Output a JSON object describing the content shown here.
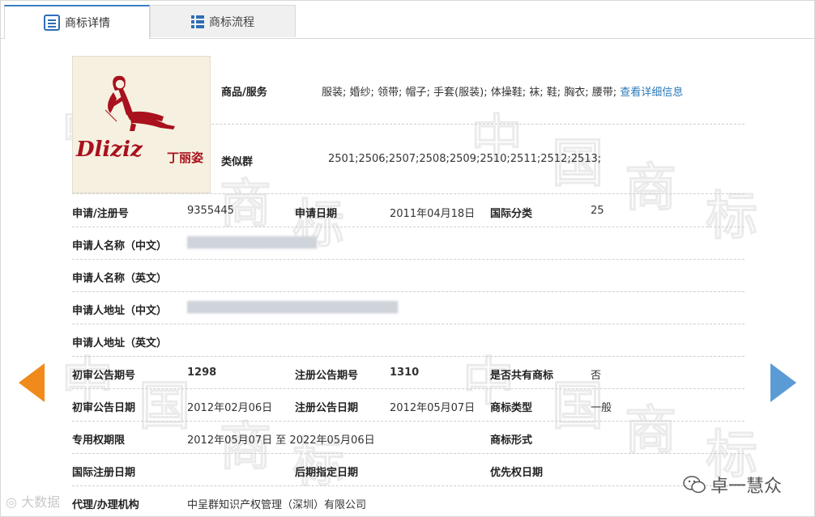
{
  "tabs": [
    {
      "label": "商标详情",
      "active": true
    },
    {
      "label": "商标流程",
      "active": false
    }
  ],
  "logo": {
    "latin_text": "Dliziz",
    "cn_text": "丁丽姿"
  },
  "goods": {
    "label": "商品/服务",
    "value": "服装; 婚纱; 领带; 帽子; 手套(服装); 体操鞋; 袜; 鞋; 胸衣; 腰带;",
    "link": "查看详细信息"
  },
  "similar_group": {
    "label": "类似群",
    "value": "2501;2506;2507;2508;2509;2510;2511;2512;2513;"
  },
  "fields": {
    "reg_no_label": "申请/注册号",
    "reg_no": "9355445",
    "apply_date_label": "申请日期",
    "apply_date": "2011年04月18日",
    "intl_class_label": "国际分类",
    "intl_class": "25",
    "applicant_cn_label": "申请人名称（中文）",
    "applicant_en_label": "申请人名称（英文）",
    "address_cn_label": "申请人地址（中文）",
    "address_en_label": "申请人地址（英文）",
    "prelim_no_label": "初审公告期号",
    "prelim_no": "1298",
    "reg_pub_no_label": "注册公告期号",
    "reg_pub_no": "1310",
    "shared_label": "是否共有商标",
    "shared": "否",
    "prelim_date_label": "初审公告日期",
    "prelim_date": "2012年02月06日",
    "reg_pub_date_label": "注册公告日期",
    "reg_pub_date": "2012年05月07日",
    "mark_type_label": "商标类型",
    "mark_type": "一般",
    "exclusive_label": "专用权期限",
    "exclusive": "2012年05月07日 至 2022年05月06日",
    "mark_form_label": "商标形式",
    "intl_reg_date_label": "国际注册日期",
    "later_date_label": "后期指定日期",
    "priority_date_label": "优先权日期",
    "agent_label": "代理/办理机构",
    "agent": "中呈群知识产权管理（深圳）有限公司"
  },
  "watermark": {
    "chars": [
      "中",
      "国",
      "商",
      "标"
    ]
  },
  "corner": {
    "left_text": "大数据",
    "right_text": "卓一慧众"
  },
  "colors": {
    "accent": "#3a7ec8",
    "link": "#2a7ab8",
    "arrow_left": "#f08a1a",
    "arrow_right": "#5b9bd5",
    "logo_red": "#a8111d"
  }
}
